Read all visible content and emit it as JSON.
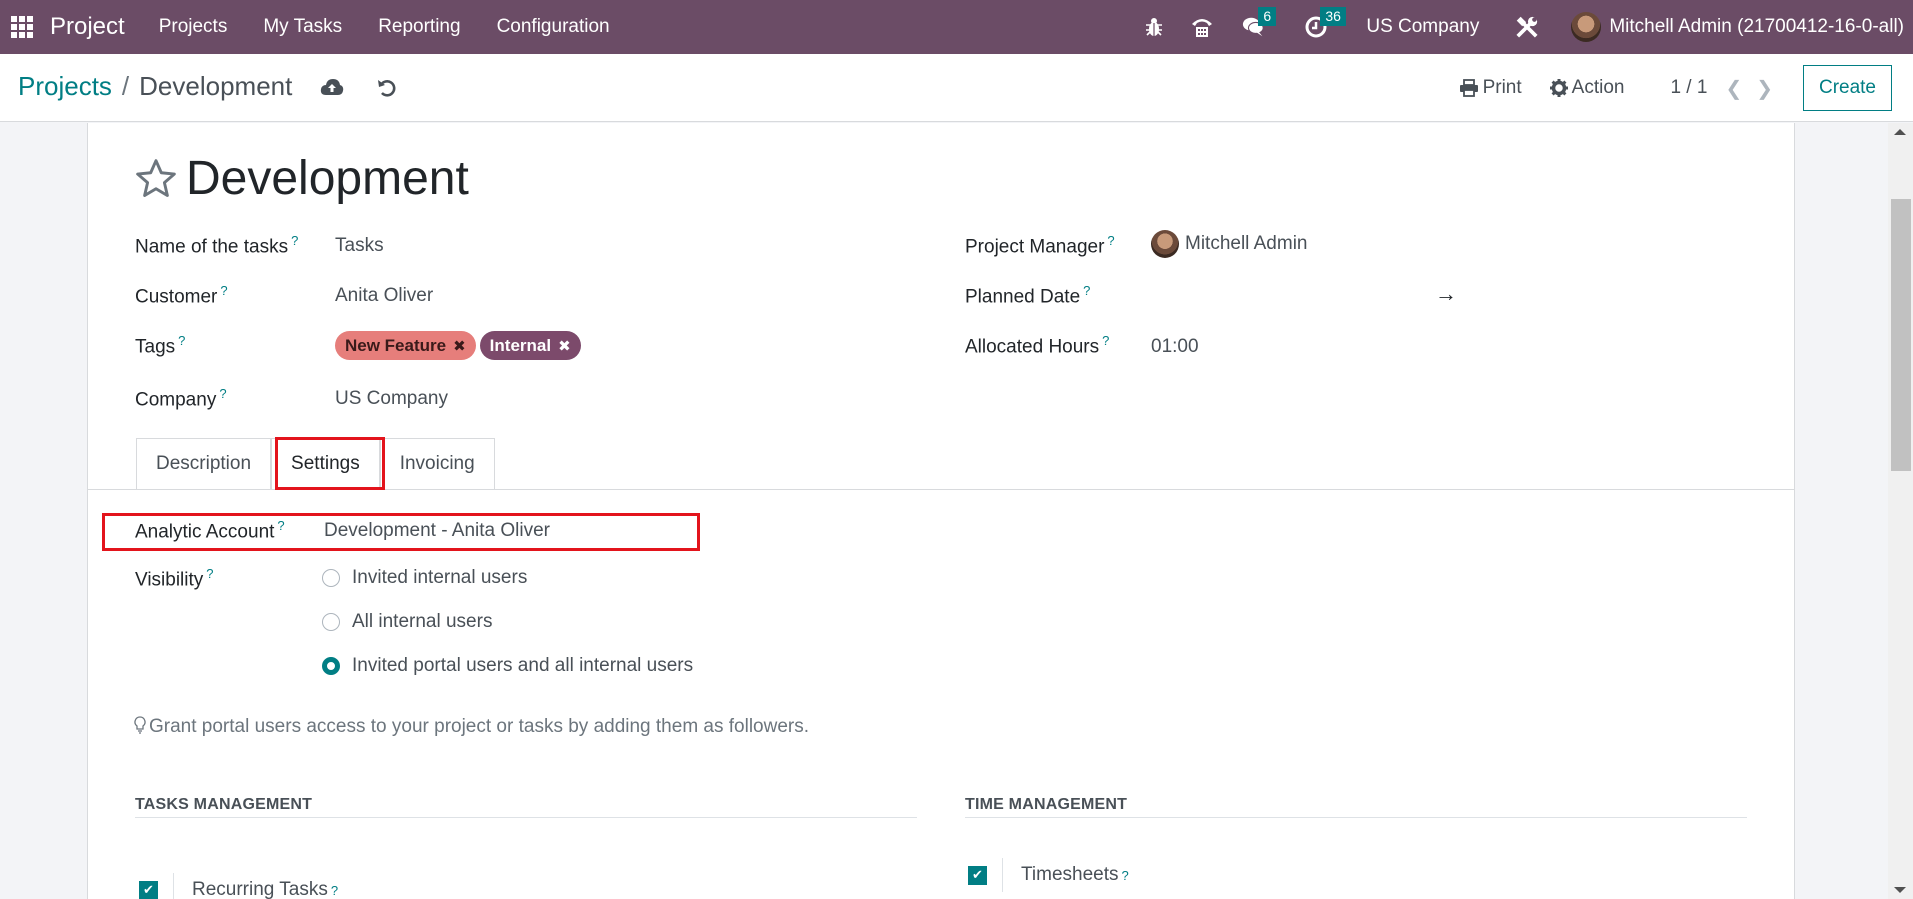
{
  "navbar": {
    "brand": "Project",
    "menu": [
      "Projects",
      "My Tasks",
      "Reporting",
      "Configuration"
    ],
    "messages_count": "6",
    "activities_count": "36",
    "company": "US Company",
    "user": "Mitchell Admin (21700412-16-0-all)"
  },
  "control_panel": {
    "breadcrumb_parent": "Projects",
    "breadcrumb_separator": "/",
    "breadcrumb_current": "Development",
    "print_label": "Print",
    "action_label": "Action",
    "pager": "1 / 1",
    "create_label": "Create"
  },
  "record": {
    "title": "Development",
    "left_fields": [
      {
        "label": "Name of the tasks",
        "value": "Tasks"
      },
      {
        "label": "Customer",
        "value": "Anita Oliver"
      },
      {
        "label": "Tags",
        "tags": [
          {
            "name": "New Feature",
            "color": "#e67e7b"
          },
          {
            "name": "Internal",
            "color": "#7c4a6b"
          }
        ]
      },
      {
        "label": "Company",
        "value": "US Company"
      }
    ],
    "right_fields": [
      {
        "label": "Project Manager",
        "value": "Mitchell Admin"
      },
      {
        "label": "Planned Date",
        "value": "→"
      },
      {
        "label": "Allocated Hours",
        "value": "01:00"
      }
    ],
    "help_mark": "?"
  },
  "tabs": [
    {
      "label": "Description",
      "active": false
    },
    {
      "label": "Settings",
      "active": true
    },
    {
      "label": "Invoicing",
      "active": false
    }
  ],
  "settings": {
    "analytic_account_label": "Analytic Account",
    "analytic_account_value": "Development - Anita Oliver",
    "visibility_label": "Visibility",
    "visibility_options": [
      {
        "label": "Invited internal users",
        "selected": false
      },
      {
        "label": "All internal users",
        "selected": false
      },
      {
        "label": "Invited portal users and all internal users",
        "selected": true
      }
    ],
    "hint": "Grant portal users access to your project or tasks by adding them as followers.",
    "tasks_management_title": "TASKS MANAGEMENT",
    "time_management_title": "TIME MANAGEMENT",
    "recurring_tasks_label": "Recurring Tasks",
    "recurring_tasks_checked": true,
    "timesheets_label": "Timesheets",
    "timesheets_checked": true
  },
  "colors": {
    "navbar": "#6b4c66",
    "accent": "#017e84",
    "annotation": "#e3141c"
  }
}
